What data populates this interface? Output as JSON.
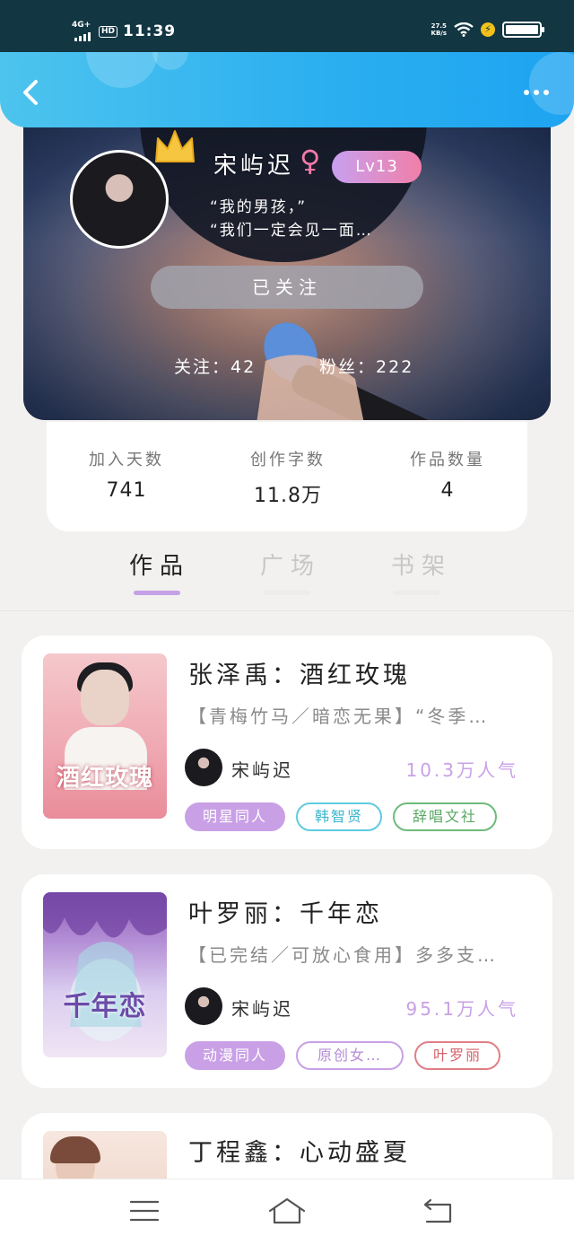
{
  "status_bar": {
    "network": "4G+",
    "hd": "HD",
    "time": "11:39",
    "speed_value": "27.5",
    "speed_unit": "KB/s",
    "battery_level": 1.0
  },
  "header": {
    "back_icon": "chevron-left-icon",
    "more_icon": "more-horizontal-icon"
  },
  "profile": {
    "username": "宋屿迟",
    "gender_symbol": "♀",
    "level": "Lv13",
    "bio_line1": "“我的男孩，”",
    "bio_line2": "“我们一定会见一面…",
    "follow_label": "已关注",
    "following_label": "关注：",
    "following_count": "42",
    "fans_label": "粉丝：",
    "fans_count": "222"
  },
  "stats": [
    {
      "label": "加入天数",
      "value": "741"
    },
    {
      "label": "创作字数",
      "value": "11.8万"
    },
    {
      "label": "作品数量",
      "value": "4"
    }
  ],
  "tabs": [
    {
      "label": "作品",
      "active": true
    },
    {
      "label": "广场",
      "active": false
    },
    {
      "label": "书架",
      "active": false
    }
  ],
  "books": [
    {
      "title": "张泽禹：酒红玫瑰",
      "desc": "【青梅竹马／暗恋无果】“冬季…",
      "author": "宋屿迟",
      "popularity": "10.3万人气",
      "cover_title": "酒红玫瑰",
      "tags": [
        {
          "label": "明星同人",
          "style": "filled",
          "color": "#c9a0e6"
        },
        {
          "label": "韩智贤",
          "style": "outline",
          "color": "#5fcbe0"
        },
        {
          "label": "辞唱文社",
          "style": "outline",
          "color": "#6dbb7a"
        }
      ]
    },
    {
      "title": "叶罗丽：千年恋",
      "desc": "【已完结／可放心食用】多多支…",
      "author": "宋屿迟",
      "popularity": "95.1万人气",
      "cover_title": "千年恋",
      "tags": [
        {
          "label": "动漫同人",
          "style": "filled",
          "color": "#c9a0e6"
        },
        {
          "label": "原创女…",
          "style": "outline",
          "color": "#c9a0e6"
        },
        {
          "label": "叶罗丽",
          "style": "outline",
          "color": "#e07f86"
        }
      ]
    },
    {
      "title": "丁程鑫：心动盛夏"
    }
  ],
  "navbar": {
    "menu_icon": "menu-icon",
    "home_icon": "home-icon",
    "back_icon": "back-arrow-icon"
  }
}
